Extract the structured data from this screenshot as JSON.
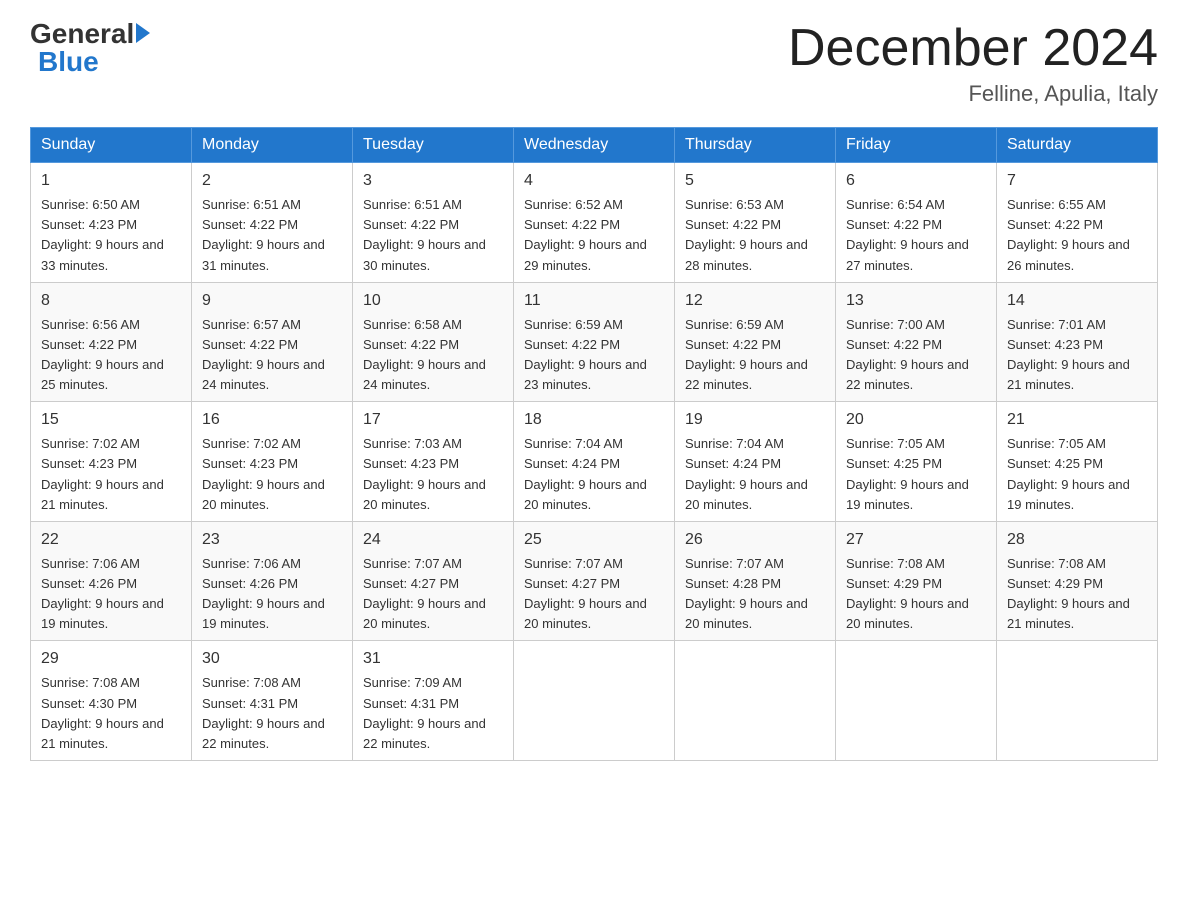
{
  "header": {
    "logo_general": "General",
    "logo_blue": "Blue",
    "month_title": "December 2024",
    "location": "Felline, Apulia, Italy"
  },
  "days_of_week": [
    "Sunday",
    "Monday",
    "Tuesday",
    "Wednesday",
    "Thursday",
    "Friday",
    "Saturday"
  ],
  "weeks": [
    [
      {
        "day": "1",
        "sunrise": "6:50 AM",
        "sunset": "4:23 PM",
        "daylight": "9 hours and 33 minutes."
      },
      {
        "day": "2",
        "sunrise": "6:51 AM",
        "sunset": "4:22 PM",
        "daylight": "9 hours and 31 minutes."
      },
      {
        "day": "3",
        "sunrise": "6:51 AM",
        "sunset": "4:22 PM",
        "daylight": "9 hours and 30 minutes."
      },
      {
        "day": "4",
        "sunrise": "6:52 AM",
        "sunset": "4:22 PM",
        "daylight": "9 hours and 29 minutes."
      },
      {
        "day": "5",
        "sunrise": "6:53 AM",
        "sunset": "4:22 PM",
        "daylight": "9 hours and 28 minutes."
      },
      {
        "day": "6",
        "sunrise": "6:54 AM",
        "sunset": "4:22 PM",
        "daylight": "9 hours and 27 minutes."
      },
      {
        "day": "7",
        "sunrise": "6:55 AM",
        "sunset": "4:22 PM",
        "daylight": "9 hours and 26 minutes."
      }
    ],
    [
      {
        "day": "8",
        "sunrise": "6:56 AM",
        "sunset": "4:22 PM",
        "daylight": "9 hours and 25 minutes."
      },
      {
        "day": "9",
        "sunrise": "6:57 AM",
        "sunset": "4:22 PM",
        "daylight": "9 hours and 24 minutes."
      },
      {
        "day": "10",
        "sunrise": "6:58 AM",
        "sunset": "4:22 PM",
        "daylight": "9 hours and 24 minutes."
      },
      {
        "day": "11",
        "sunrise": "6:59 AM",
        "sunset": "4:22 PM",
        "daylight": "9 hours and 23 minutes."
      },
      {
        "day": "12",
        "sunrise": "6:59 AM",
        "sunset": "4:22 PM",
        "daylight": "9 hours and 22 minutes."
      },
      {
        "day": "13",
        "sunrise": "7:00 AM",
        "sunset": "4:22 PM",
        "daylight": "9 hours and 22 minutes."
      },
      {
        "day": "14",
        "sunrise": "7:01 AM",
        "sunset": "4:23 PM",
        "daylight": "9 hours and 21 minutes."
      }
    ],
    [
      {
        "day": "15",
        "sunrise": "7:02 AM",
        "sunset": "4:23 PM",
        "daylight": "9 hours and 21 minutes."
      },
      {
        "day": "16",
        "sunrise": "7:02 AM",
        "sunset": "4:23 PM",
        "daylight": "9 hours and 20 minutes."
      },
      {
        "day": "17",
        "sunrise": "7:03 AM",
        "sunset": "4:23 PM",
        "daylight": "9 hours and 20 minutes."
      },
      {
        "day": "18",
        "sunrise": "7:04 AM",
        "sunset": "4:24 PM",
        "daylight": "9 hours and 20 minutes."
      },
      {
        "day": "19",
        "sunrise": "7:04 AM",
        "sunset": "4:24 PM",
        "daylight": "9 hours and 20 minutes."
      },
      {
        "day": "20",
        "sunrise": "7:05 AM",
        "sunset": "4:25 PM",
        "daylight": "9 hours and 19 minutes."
      },
      {
        "day": "21",
        "sunrise": "7:05 AM",
        "sunset": "4:25 PM",
        "daylight": "9 hours and 19 minutes."
      }
    ],
    [
      {
        "day": "22",
        "sunrise": "7:06 AM",
        "sunset": "4:26 PM",
        "daylight": "9 hours and 19 minutes."
      },
      {
        "day": "23",
        "sunrise": "7:06 AM",
        "sunset": "4:26 PM",
        "daylight": "9 hours and 19 minutes."
      },
      {
        "day": "24",
        "sunrise": "7:07 AM",
        "sunset": "4:27 PM",
        "daylight": "9 hours and 20 minutes."
      },
      {
        "day": "25",
        "sunrise": "7:07 AM",
        "sunset": "4:27 PM",
        "daylight": "9 hours and 20 minutes."
      },
      {
        "day": "26",
        "sunrise": "7:07 AM",
        "sunset": "4:28 PM",
        "daylight": "9 hours and 20 minutes."
      },
      {
        "day": "27",
        "sunrise": "7:08 AM",
        "sunset": "4:29 PM",
        "daylight": "9 hours and 20 minutes."
      },
      {
        "day": "28",
        "sunrise": "7:08 AM",
        "sunset": "4:29 PM",
        "daylight": "9 hours and 21 minutes."
      }
    ],
    [
      {
        "day": "29",
        "sunrise": "7:08 AM",
        "sunset": "4:30 PM",
        "daylight": "9 hours and 21 minutes."
      },
      {
        "day": "30",
        "sunrise": "7:08 AM",
        "sunset": "4:31 PM",
        "daylight": "9 hours and 22 minutes."
      },
      {
        "day": "31",
        "sunrise": "7:09 AM",
        "sunset": "4:31 PM",
        "daylight": "9 hours and 22 minutes."
      },
      null,
      null,
      null,
      null
    ]
  ]
}
